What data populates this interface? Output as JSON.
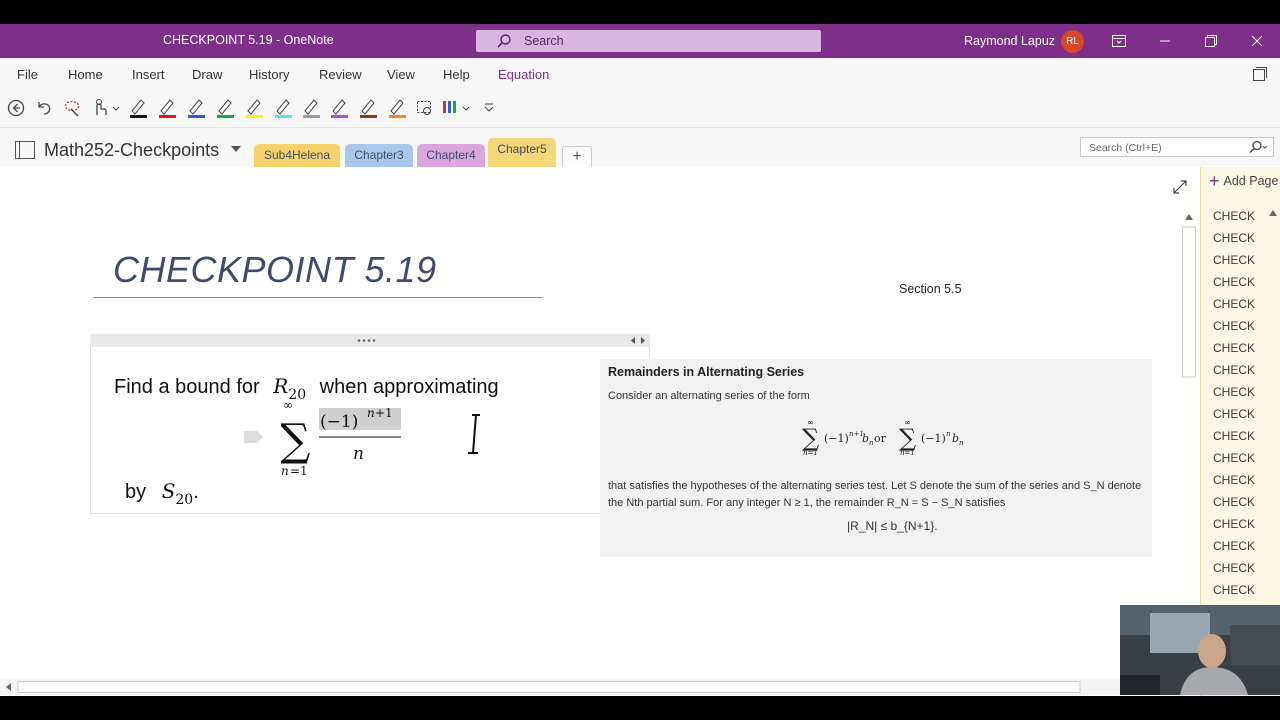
{
  "window": {
    "title": "CHECKPOINT 5.19 - OneNote",
    "search_label": "Search",
    "user_name": "Raymond Lapuz",
    "user_initials": "RL"
  },
  "menu": {
    "items": [
      "File",
      "Home",
      "Insert",
      "Draw",
      "History",
      "Review",
      "View",
      "Help",
      "Equation"
    ],
    "active": "Equation"
  },
  "notebook": {
    "name": "Math252-Checkpoints",
    "sections": [
      {
        "label": "Sub4Helena",
        "color": "#f5d26b"
      },
      {
        "label": "Chapter3",
        "color": "#a9c7e8"
      },
      {
        "label": "Chapter4",
        "color": "#d9a6dd"
      },
      {
        "label": "Chapter5",
        "color": "#f3d879"
      }
    ],
    "active_section": "Chapter5",
    "search_placeholder": "Search (Ctrl+E)"
  },
  "page": {
    "title": "CHECKPOINT 5.19",
    "section_note": "Section 5.5",
    "question": {
      "line1_before": "Find a bound for",
      "line1_var": "R",
      "line1_sub": "20",
      "line1_after": "when approximating",
      "line2_before": "by",
      "line2_var": "S",
      "line2_sub": "20",
      "line2_after": "."
    },
    "reference": {
      "heading": "Remainders in Alternating Series",
      "intro": "Consider an alternating series of the form",
      "series_joiner": "or",
      "body": "that satisfies the hypotheses of the alternating series test. Let S denote the sum of the series and S_N denote the Nth partial sum. For any integer N ≥ 1, the remainder R_N = S − S_N satisfies",
      "inequality": "|R_N| ≤ b_{N+1}."
    }
  },
  "pagelist": {
    "add_label": "Add Page",
    "items": [
      "CHECK",
      "CHECK",
      "CHECK",
      "CHECK",
      "CHECK",
      "CHECK",
      "CHECK",
      "CHECK",
      "CHECK",
      "CHECK",
      "CHECK",
      "CHECK",
      "CHECK",
      "CHECK",
      "CHECK",
      "CHECK",
      "CHECK",
      "CHECK"
    ]
  },
  "colors": {
    "brand": "#7d2f89",
    "pagelist_bg": "#fdf8e4",
    "section_line": "#f3d879"
  }
}
